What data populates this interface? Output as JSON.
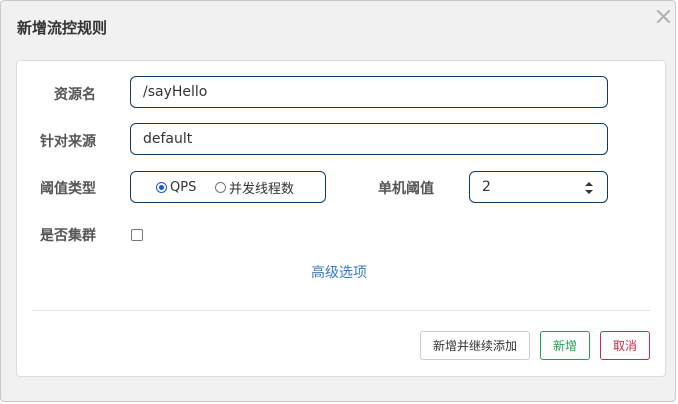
{
  "dialog": {
    "title": "新增流控规则",
    "close_icon": "close-icon"
  },
  "form": {
    "resource_name": {
      "label": "资源名",
      "value": "/sayHello"
    },
    "limit_app": {
      "label": "针对来源",
      "value": "default"
    },
    "threshold_type": {
      "label": "阈值类型",
      "options": [
        {
          "label": "QPS",
          "checked": true
        },
        {
          "label": "并发线程数",
          "checked": false
        }
      ]
    },
    "single_threshold": {
      "label": "单机阈值",
      "value": "2"
    },
    "cluster_mode": {
      "label": "是否集群",
      "checked": false
    },
    "advanced_link": "高级选项"
  },
  "footer": {
    "add_continue_label": "新增并继续添加",
    "add_label": "新增",
    "cancel_label": "取消"
  },
  "colors": {
    "input_border": "#0e3d66",
    "link": "#3a7ac4",
    "success": "#1e9e57",
    "danger": "#c22e4c",
    "radio_checked": "#1a56d6"
  }
}
